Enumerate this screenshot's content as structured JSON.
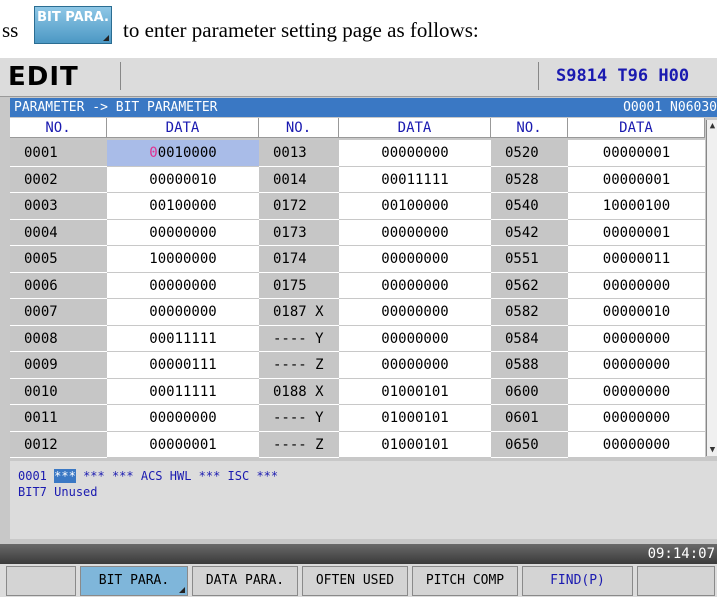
{
  "intro": {
    "prefix": "ss",
    "button_label": "BIT PARA.",
    "suffix": "to enter parameter setting page as follows:"
  },
  "screen": {
    "mode": "EDIT",
    "spindle": "S9814  T96  H00",
    "path": "PARAMETER -> BIT PARAMETER",
    "program": "O0001  N06030",
    "headers": [
      "NO.",
      "DATA",
      "NO.",
      "DATA",
      "NO.",
      "DATA"
    ],
    "rows": [
      [
        "0001",
        "00010000",
        "0013",
        "00000000",
        "0520",
        "00000001"
      ],
      [
        "0002",
        "00000010",
        "0014",
        "00011111",
        "0528",
        "00000001"
      ],
      [
        "0003",
        "00100000",
        "0172",
        "00100000",
        "0540",
        "10000100"
      ],
      [
        "0004",
        "00000000",
        "0173",
        "00000000",
        "0542",
        "00000001"
      ],
      [
        "0005",
        "10000000",
        "0174",
        "00000000",
        "0551",
        "00000011"
      ],
      [
        "0006",
        "00000000",
        "0175",
        "00000000",
        "0562",
        "00000000"
      ],
      [
        "0007",
        "00000000",
        "0187 X",
        "00000000",
        "0582",
        "00000010"
      ],
      [
        "0008",
        "00011111",
        "---- Y",
        "00000000",
        "0584",
        "00000000"
      ],
      [
        "0009",
        "00000111",
        "---- Z",
        "00000000",
        "0588",
        "00000000"
      ],
      [
        "0010",
        "00011111",
        "0188 X",
        "01000101",
        "0600",
        "00000000"
      ],
      [
        "0011",
        "00000000",
        "---- Y",
        "01000101",
        "0601",
        "00000000"
      ],
      [
        "0012",
        "00000001",
        "---- Z",
        "01000101",
        "0650",
        "00000000"
      ]
    ],
    "selected_cursor_digit": "0",
    "selected_rest": "0010000",
    "bit_line": {
      "param": "0001",
      "selected_bit": "***",
      "rest": "*** *** ACS HWL *** ISC ***"
    },
    "bit_desc": {
      "bit": "BIT7",
      "desc": "Unused"
    },
    "time": "09:14:07",
    "softkeys": [
      "",
      "BIT PARA.",
      "DATA PARA.",
      "OFTEN USED",
      "PITCH COMP",
      "FIND(P)",
      ""
    ]
  },
  "colors": {
    "header_text": "#1a1ab0",
    "path_bar": "#3a78c4",
    "selected_cell": "#a9bce8",
    "cursor_digit": "#e03090",
    "active_softkey": "#7fb6da"
  }
}
